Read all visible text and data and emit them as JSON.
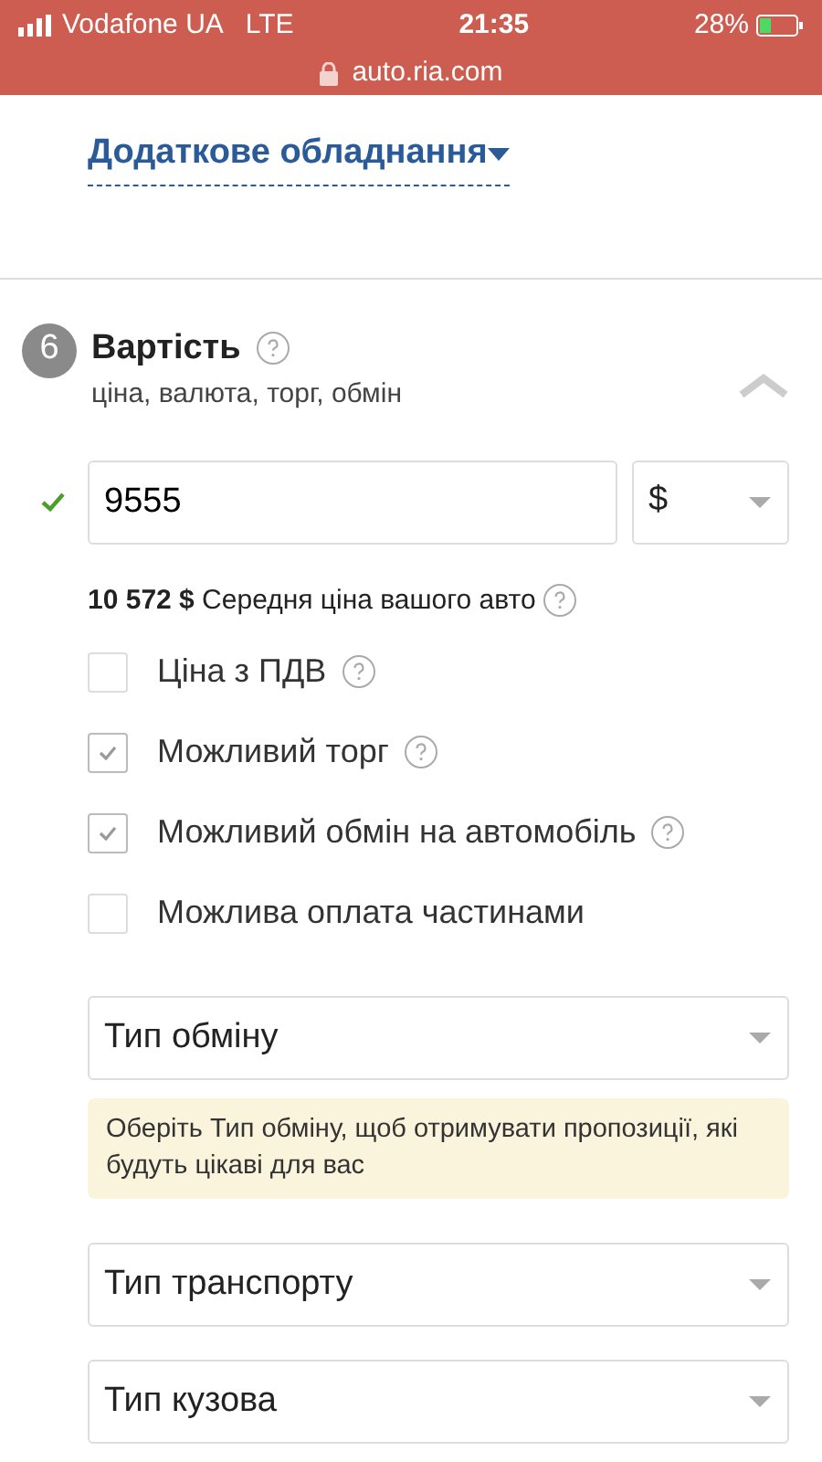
{
  "status_bar": {
    "carrier": "Vodafone UA",
    "network": "LTE",
    "time": "21:35",
    "battery": "28%",
    "url": "auto.ria.com"
  },
  "equipment_link": "Додаткове обладнання",
  "section": {
    "number": "6",
    "title": "Вартість",
    "subtitle": "ціна, валюта, торг, обмін",
    "expanded": true
  },
  "price": {
    "value": "9555",
    "valid": true,
    "currency": "$"
  },
  "average": {
    "amount": "10 572 $",
    "label": "Середня ціна вашого авто"
  },
  "options": [
    {
      "label": "Ціна з ПДВ",
      "checked": false,
      "help": true
    },
    {
      "label": "Можливий торг",
      "checked": true,
      "help": true
    },
    {
      "label": "Можливий обмін на автомобіль",
      "checked": true,
      "help": true
    },
    {
      "label": "Можлива оплата частинами",
      "checked": false,
      "help": false
    }
  ],
  "selects": [
    {
      "placeholder": "Тип обміну",
      "hint": "Оберіть Тип обміну, щоб отримувати пропозиції, які будуть цікаві для вас"
    },
    {
      "placeholder": "Тип транспорту"
    },
    {
      "placeholder": "Тип кузова"
    }
  ]
}
